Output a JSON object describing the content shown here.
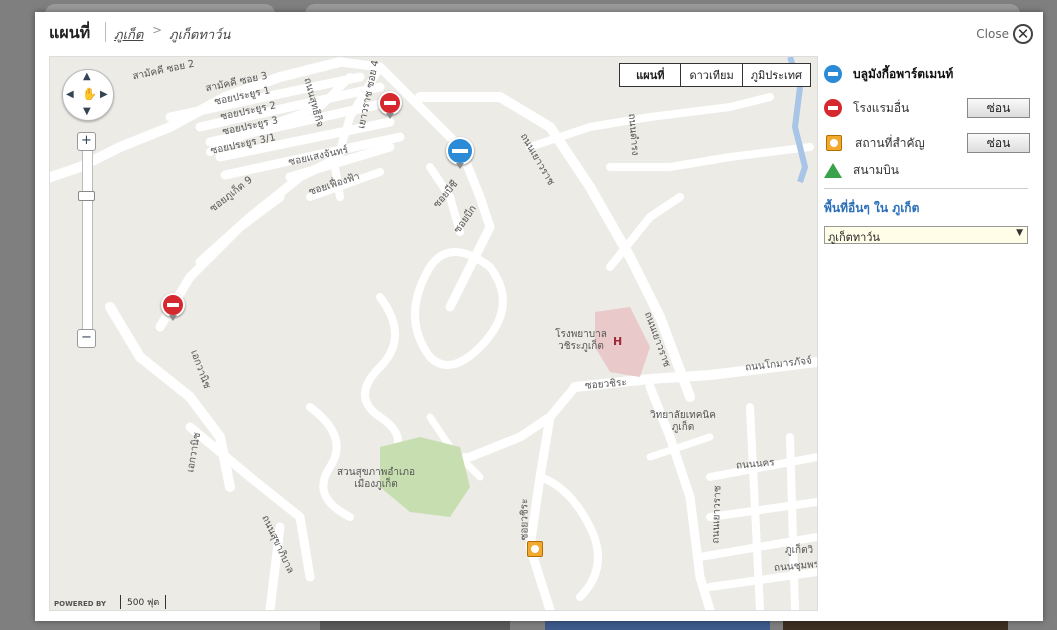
{
  "header": {
    "title": "แผนที่",
    "breadcrumb_link": "ภูเก็ต",
    "breadcrumb_current": "ภูเก็ตทาว์น",
    "close_label": "Close"
  },
  "map": {
    "type_tabs": [
      "แผนที่",
      "ดาวเทียม",
      "ภูมิประเทศ"
    ],
    "road_labels": [
      "สามัคคี ซอย 2",
      "สามัคคี ซอย 3",
      "ซอยประยูร 1",
      "ซอยประยูร 2",
      "ซอยประยูร 3",
      "ซอยประยูร 3/1",
      "ซอยแสงจันทร์",
      "ซอยเฟื่องฟ้า",
      "ซอยภูเก็ต 9",
      "ถนนเยาวราช",
      "ซอยบีชี",
      "ซอยบีก",
      "ถนนโกมารภัจจ์",
      "ซอยวชิระ",
      "ถนนนคร",
      "ถนนชุมพร",
      "ถนนสุทธิกิจ",
      "ถนนสุขาภิบาล",
      "เอกวานิช",
      "เยาวราช ซอย 4",
      "ถนนดำรง"
    ],
    "places": {
      "hospital": "โรงพยาบาลวชิระภูเก็ต",
      "college": "วิทยาลัยเทคนิคภูเก็ต",
      "park": "สวนสุขภาพอำเภอเมืองภูเก็ต",
      "other": "ภูเก็ตวิ"
    },
    "powered_by": "POWERED BY",
    "scale": "500 ฟุต"
  },
  "legend": {
    "hotel_name": "บลูมังกี้อพาร์ตเมนท์",
    "other_hotels": "โรงแรมอื่น",
    "landmarks": "สถานที่สำคัญ",
    "airport": "สนามบิน",
    "hide_button": "ซ่อน"
  },
  "other_areas": {
    "title": "พื้นที่อื่นๆ ใน ภูเก็ต",
    "selected": "ภูเก็ตทาว์น"
  }
}
